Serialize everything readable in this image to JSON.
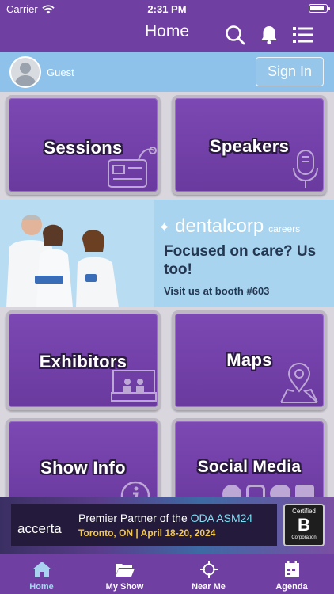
{
  "status": {
    "carrier": "Carrier",
    "time": "2:31 PM"
  },
  "header": {
    "title": "Home"
  },
  "user": {
    "name": "Guest",
    "signin_label": "Sign In"
  },
  "tiles": [
    {
      "label": "Sessions",
      "icon": "id-badge-icon"
    },
    {
      "label": "Speakers",
      "icon": "microphone-icon"
    },
    {
      "label": "Exhibitors",
      "icon": "exhibitor-booth-icon"
    },
    {
      "label": "Maps",
      "icon": "map-pin-icon"
    },
    {
      "label": "Show Info",
      "icon": "info-icon"
    },
    {
      "label": "Social Media",
      "icon": "social-icons"
    }
  ],
  "ad_banner": {
    "brand": "dentalcorp",
    "brand_sub": "careers",
    "headline": "Focused on care? Us too!",
    "booth": "Visit us at booth #603"
  },
  "bottom_ad": {
    "logo": "accerta",
    "title_prefix": "Premier Partner of the ",
    "title_highlight": "ODA ASM24",
    "subtitle": "Toronto, ON  |  April 18-20, 2024",
    "badge_top": "Certified",
    "badge_letter": "B",
    "badge_bottom": "Corporation"
  },
  "tabs": [
    {
      "label": "Home",
      "icon": "home-icon",
      "active": true
    },
    {
      "label": "My Show",
      "icon": "folder-icon",
      "active": false
    },
    {
      "label": "Near Me",
      "icon": "crosshair-icon",
      "active": false
    },
    {
      "label": "Agenda",
      "icon": "calendar-icon",
      "active": false
    }
  ],
  "colors": {
    "primary": "#6f3fa2",
    "accent": "#a8d4f0",
    "userbar": "#8fc2ea"
  }
}
